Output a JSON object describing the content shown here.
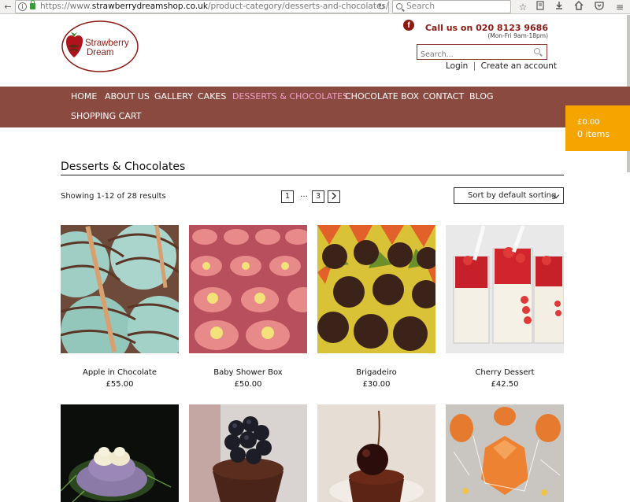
{
  "browser": {
    "url_prefix": "https://www.",
    "url_domain": "strawberrydreamshop.co.uk",
    "url_path": "/product-category/desserts-and-chocolates/",
    "search_placeholder": "Search"
  },
  "header": {
    "logo_line1": "Strawberry",
    "logo_line2": "Dream",
    "phone": "Call us on 020 8123 9686",
    "hours": "(Mon-Fri 9am-18pm)",
    "search_placeholder": "Search...",
    "login": "Login",
    "separator": "|",
    "create_account": "Create an account"
  },
  "nav": {
    "items": [
      "HOME",
      "ABOUT US",
      "GALLERY",
      "CAKES",
      "DESSERTS & CHOCOLATES",
      "CHOCOLATE BOX",
      "CONTACT",
      "BLOG",
      "SHOPPING CART"
    ]
  },
  "cart": {
    "amount": "£0.00",
    "items": "0 items"
  },
  "main": {
    "title": "Desserts & Chocolates",
    "result_count": "Showing 1-12 of 28 results",
    "pagination": [
      "1",
      "…",
      "3"
    ],
    "sort_label": "Sort by default sorting"
  },
  "products": [
    {
      "name": "Apple in Chocolate",
      "price": "£55.00"
    },
    {
      "name": "Baby Shower Box",
      "price": "£50.00"
    },
    {
      "name": "Brigadeiro",
      "price": "£30.00"
    },
    {
      "name": "Cherry Dessert",
      "price": "£42.50"
    }
  ],
  "colors": {
    "brand": "#8b1a14",
    "nav_bg": "#8b4a40",
    "nav_active": "#f29ec8",
    "cart_bg": "#f5a400"
  }
}
